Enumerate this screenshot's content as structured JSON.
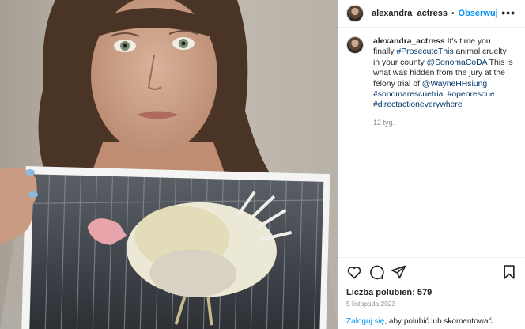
{
  "post": {
    "username": "alexandra_actress",
    "follow_label": "Obserwuj",
    "more_label": "•••",
    "caption_segments": [
      "It's time you finally ",
      "#ProsecuteThis",
      " animal cruelty in your county ",
      "@SonomaCoDA",
      " This is what was hidden from the jury at the felony trial of ",
      "@WayneHHsiung",
      " ",
      "#sonomarescuetrial",
      " ",
      "#openrescue",
      " ",
      "#directactioneverywhere"
    ],
    "caption_time": "12 tyg.",
    "likes_label": "Liczba polubień: 579",
    "date": "5 listopada 2023",
    "login_link": "Zaloguj się",
    "login_rest": ", aby polubić lub skomentować."
  },
  "icons": [
    "heart-icon",
    "comment-icon",
    "share-icon",
    "bookmark-icon"
  ],
  "colors": {
    "link": "#0095f6",
    "hashtag": "#00376b",
    "muted": "#8e8e8e"
  }
}
